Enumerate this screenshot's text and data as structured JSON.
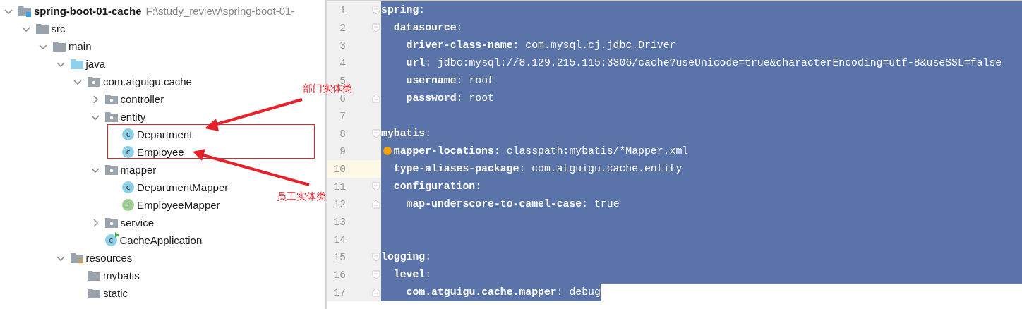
{
  "project_tree": [
    {
      "label": "spring-boot-01-cache",
      "path": "F:\\study_review\\spring-boot-01-",
      "kind": "module",
      "expanded": true,
      "children": [
        {
          "label": "src",
          "kind": "folder",
          "expanded": true,
          "children": [
            {
              "label": "main",
              "kind": "folder",
              "expanded": true,
              "children": [
                {
                  "label": "java",
                  "kind": "source-root",
                  "expanded": true,
                  "children": [
                    {
                      "label": "com.atguigu.cache",
                      "kind": "package",
                      "expanded": true,
                      "children": [
                        {
                          "label": "controller",
                          "kind": "package",
                          "expanded": false
                        },
                        {
                          "label": "entity",
                          "kind": "package",
                          "expanded": true,
                          "children": [
                            {
                              "label": "Department",
                              "kind": "class",
                              "letter": "c"
                            },
                            {
                              "label": "Employee",
                              "kind": "class",
                              "letter": "c"
                            }
                          ]
                        },
                        {
                          "label": "mapper",
                          "kind": "package",
                          "expanded": true,
                          "children": [
                            {
                              "label": "DepartmentMapper",
                              "kind": "class",
                              "letter": "c"
                            },
                            {
                              "label": "EmployeeMapper",
                              "kind": "interface",
                              "letter": "I"
                            }
                          ]
                        },
                        {
                          "label": "service",
                          "kind": "package",
                          "expanded": false
                        },
                        {
                          "label": "CacheApplication",
                          "kind": "application",
                          "letter": "c"
                        }
                      ]
                    }
                  ]
                },
                {
                  "label": "resources",
                  "kind": "resources",
                  "expanded": true,
                  "children": [
                    {
                      "label": "mybatis",
                      "kind": "folder"
                    },
                    {
                      "label": "static",
                      "kind": "folder"
                    }
                  ]
                }
              ]
            }
          ]
        }
      ]
    }
  ],
  "editor_lines": [
    {
      "number": "1",
      "text": "**spring**:",
      "kind": "fold-start",
      "bulb": false,
      "current": false,
      "selected": true,
      "children": [
        {
          "number": "2",
          "text": "**datasource**:",
          "kind": "fold-start",
          "bulb": false,
          "current": false,
          "selected": true,
          "children": [
            {
              "number": "3",
              "text": "**driver-class-name**: com.mysql.cj.jdbc.Driver",
              "kind": "plain",
              "bulb": false,
              "current": false,
              "selected": true
            },
            {
              "number": "4",
              "text": "**url**: jdbc:mysql://8.129.215.115:3306/cache?useUnicode=true&characterEncoding=utf-8&useSSL=false",
              "kind": "plain",
              "bulb": false,
              "current": false,
              "selected": true
            },
            {
              "number": "5",
              "text": "**username**: root",
              "kind": "plain",
              "bulb": false,
              "current": false,
              "selected": true
            },
            {
              "number": "6",
              "text": "**password**: root",
              "kind": "fold-end",
              "bulb": false,
              "current": false,
              "selected": true
            }
          ]
        }
      ]
    },
    {
      "number": "7",
      "kind": "plain",
      "bulb": false,
      "current": false,
      "selected": true
    },
    {
      "number": "8",
      "text": "**mybatis**:",
      "kind": "fold-start",
      "bulb": false,
      "current": false,
      "selected": true,
      "children": [
        {
          "number": "9",
          "text": "**mapper-locations**: classpath:mybatis/*Mapper.xml",
          "kind": "plain",
          "bulb": true,
          "current": false,
          "selected": true
        },
        {
          "number": "10",
          "text": "**type-aliases-package**: com.atguigu.cache.entity",
          "kind": "plain",
          "bulb": false,
          "current": true,
          "selected": true
        },
        {
          "number": "11",
          "text": "**configuration**:",
          "kind": "fold-start",
          "bulb": false,
          "current": false,
          "selected": true,
          "children": [
            {
              "number": "12",
              "text": "**map-underscore-to-camel-case**: true",
              "kind": "fold-end",
              "bulb": false,
              "current": false,
              "selected": true
            }
          ]
        }
      ]
    },
    {
      "number": "13",
      "kind": "plain",
      "bulb": false,
      "current": false,
      "selected": true
    },
    {
      "number": "14",
      "kind": "plain",
      "bulb": false,
      "current": false,
      "selected": true
    },
    {
      "number": "15",
      "text": "**logging**:",
      "kind": "fold-start",
      "bulb": false,
      "current": false,
      "selected": true,
      "children": [
        {
          "number": "16",
          "text": "**level**:",
          "kind": "fold-start",
          "bulb": false,
          "current": false,
          "selected": true,
          "children": [
            {
              "number": "17",
              "text": "**com.atguigu.cache.mapper**: debug",
              "kind": "fold-end",
              "bulb": false,
              "current": false,
              "selected": true
            }
          ]
        }
      ]
    }
  ],
  "annotations": [
    {
      "label": "部门实体类"
    },
    {
      "label": "员工实体类"
    }
  ]
}
